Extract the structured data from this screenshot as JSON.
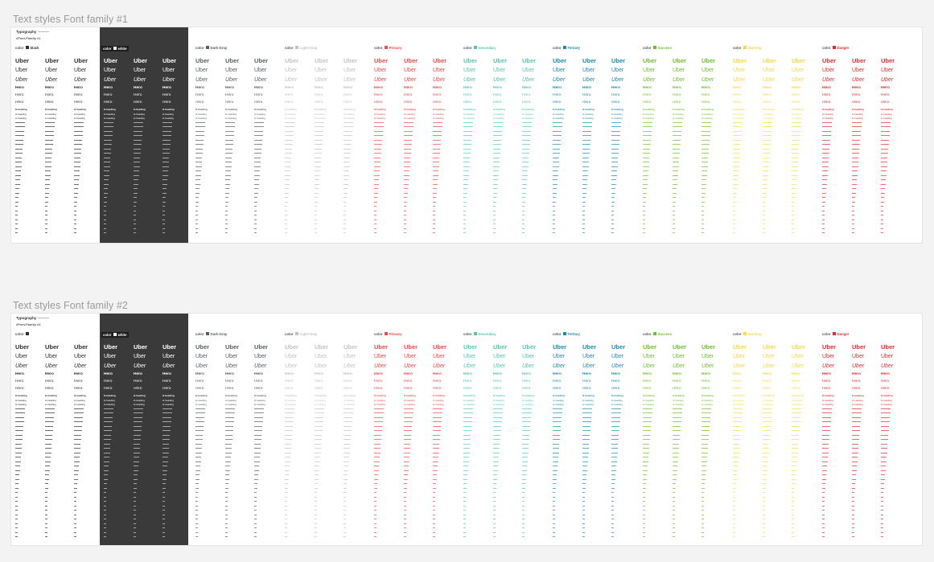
{
  "sections": [
    {
      "title": "Text styles Font family #1",
      "typography_label": "Typography",
      "family_label": "#Font-Family #1",
      "groups": [
        {
          "prefix": "color",
          "name": "black",
          "swatch": "#2e2e2e",
          "text_color": "#2e2e2e",
          "dark": false
        },
        {
          "prefix": "color",
          "name": "white",
          "swatch": "#ffffff",
          "text_color": "#ffffff",
          "dark": true
        },
        {
          "prefix": "color",
          "name": "Dark-Gray",
          "swatch": "#555d66",
          "text_color": "#555d66",
          "dark": false
        },
        {
          "prefix": "color",
          "name": "Light-Gray",
          "swatch": "#bfc3c8",
          "text_color": "#bfc3c8",
          "dark": false
        },
        {
          "prefix": "color",
          "name": "Primary",
          "swatch": "#ef4848",
          "text_color": "#ef4848",
          "dark": false
        },
        {
          "prefix": "color",
          "name": "Secondary",
          "swatch": "#52c7b1",
          "text_color": "#52c7b1",
          "dark": false
        },
        {
          "prefix": "color",
          "name": "Tertiary",
          "swatch": "#1a8ab3",
          "text_color": "#1a8ab3",
          "dark": false
        },
        {
          "prefix": "color",
          "name": "Success",
          "swatch": "#6cbf2c",
          "text_color": "#6cbf2c",
          "dark": false
        },
        {
          "prefix": "color",
          "name": "Warning",
          "swatch": "#f6d84a",
          "text_color": "#f6d84a",
          "dark": false
        },
        {
          "prefix": "color",
          "name": "Danger",
          "swatch": "#e42b2b",
          "text_color": "#e42b2b",
          "dark": false
        }
      ]
    },
    {
      "title": "Text styles Font family #2",
      "typography_label": "Typography",
      "family_label": "#Font-Family #2",
      "groups": [
        {
          "prefix": "color",
          "name": "",
          "swatch": "#2e2e2e",
          "text_color": "#2e2e2e",
          "dark": false
        },
        {
          "prefix": "color",
          "name": "white",
          "swatch": "#ffffff",
          "text_color": "#ffffff",
          "dark": true
        },
        {
          "prefix": "color",
          "name": "Dark-Gray",
          "swatch": "#555d66",
          "text_color": "#555d66",
          "dark": false
        },
        {
          "prefix": "color",
          "name": "Light-Gray",
          "swatch": "#bfc3c8",
          "text_color": "#bfc3c8",
          "dark": false
        },
        {
          "prefix": "color",
          "name": "Primary",
          "swatch": "#ef4848",
          "text_color": "#ef4848",
          "dark": false
        },
        {
          "prefix": "color",
          "name": "Secondary",
          "swatch": "#52c7b1",
          "text_color": "#52c7b1",
          "dark": false
        },
        {
          "prefix": "color",
          "name": "Tertiary",
          "swatch": "#1a8ab3",
          "text_color": "#1a8ab3",
          "dark": false
        },
        {
          "prefix": "color",
          "name": "Success",
          "swatch": "#6cbf2c",
          "text_color": "#6cbf2c",
          "dark": false
        },
        {
          "prefix": "color",
          "name": "Warning",
          "swatch": "#f6d84a",
          "text_color": "#f6d84a",
          "dark": false
        },
        {
          "prefix": "color",
          "name": "Danger",
          "swatch": "#e42b2b",
          "text_color": "#e42b2b",
          "dark": false
        }
      ]
    }
  ],
  "sample_rows": [
    {
      "text": "Uber",
      "style": "bold"
    },
    {
      "text": "Uber",
      "style": "regular"
    },
    {
      "text": "Uber",
      "style": "italic"
    },
    {
      "text": "Hero",
      "style": "bold"
    },
    {
      "text": "Hero",
      "style": "regular"
    },
    {
      "text": "Hero",
      "style": "italic"
    },
    {
      "text": "H-heading",
      "style": "bold"
    },
    {
      "text": "H-heading",
      "style": "regular"
    },
    {
      "text": "H-heading",
      "style": "italic"
    }
  ]
}
